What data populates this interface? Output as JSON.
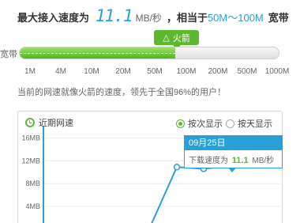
{
  "summary": {
    "prefix": "最大接入速度为",
    "speed": "11.1",
    "unit": "MB/秒",
    "equivalent_prefix": "，相当于",
    "range": "50M～100M",
    "suffix": "宽带"
  },
  "bandwidth": {
    "label": "宽带",
    "badge": "火箭",
    "badge_icon": "rocket-icon",
    "ticks": [
      "1M",
      "4M",
      "10M",
      "20M",
      "50M",
      "100M",
      "200M",
      "500M",
      "1000M"
    ],
    "level": 0.6,
    "accent": "#5cb82e"
  },
  "note": "当前的网速就像火箭的速度，领先于全国96%的用户！",
  "panel": {
    "title": "近期网速",
    "title_icon": "clock-icon",
    "option_times": "按次显示",
    "option_days": "按天显示",
    "selected": "times"
  },
  "chart_data": {
    "type": "line",
    "y_ticks": [
      "16MB",
      "12MB",
      "8MB",
      "4MB"
    ],
    "ylim": [
      0,
      18
    ],
    "values": [
      1.0,
      10.9,
      10.6,
      11.1
    ],
    "color": "#2a9fd8",
    "grid": true
  },
  "tooltip": {
    "date": "09月25日",
    "label": "下载速度为",
    "value": "11.1",
    "unit": "MB/秒"
  },
  "colors": {
    "blue": "#2a9fd8",
    "green": "#5cb82e"
  }
}
